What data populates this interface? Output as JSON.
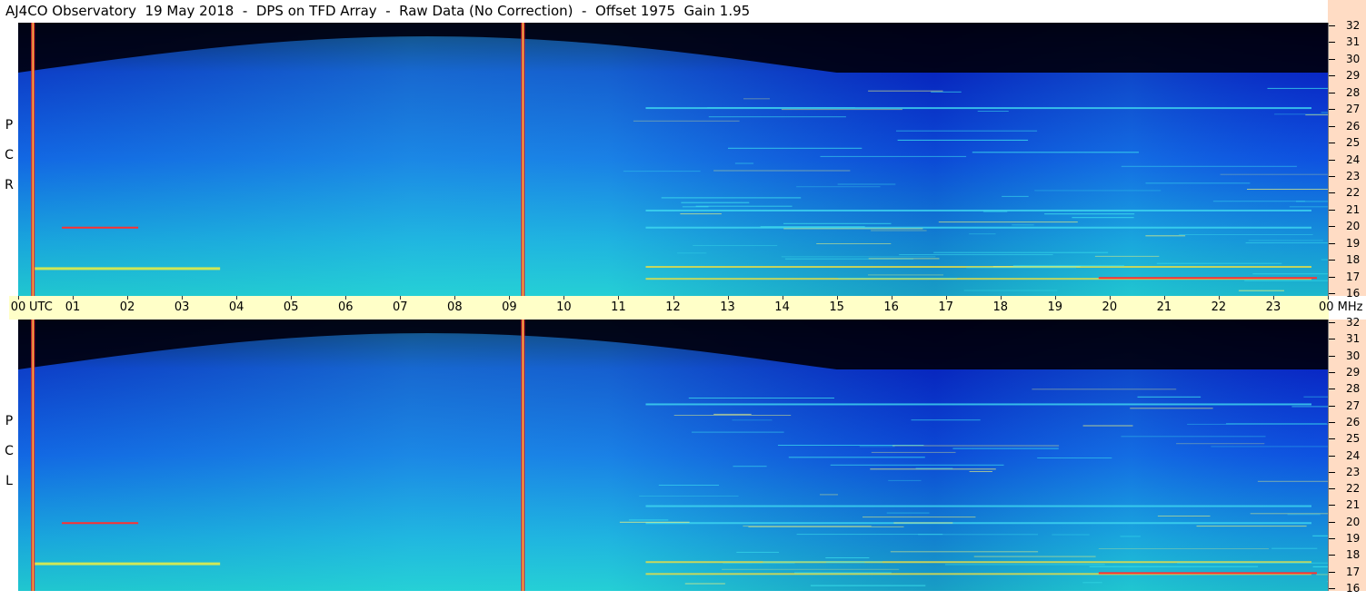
{
  "title": "AJ4CO Observatory  19 May 2018  -  DPS on TFD Array  -  Raw Data (No Correction)  -  Offset 1975  Gain 1.95",
  "panels": {
    "rcp_label": [
      "R",
      "C",
      "P"
    ],
    "lcp_label": [
      "L",
      "C",
      "P"
    ]
  },
  "time_axis": {
    "labels": [
      "00",
      "UTC",
      "01",
      "02",
      "03",
      "04",
      "05",
      "06",
      "07",
      "08",
      "09",
      "10",
      "11",
      "12",
      "13",
      "14",
      "15",
      "16",
      "17",
      "18",
      "19",
      "20",
      "21",
      "22",
      "23",
      "00 MHz"
    ],
    "hours": [
      0,
      0.3,
      1,
      2,
      3,
      4,
      5,
      6,
      7,
      8,
      9,
      10,
      11,
      12,
      13,
      14,
      15,
      16,
      17,
      18,
      19,
      20,
      21,
      22,
      23,
      24
    ]
  },
  "freq_axis": {
    "labels": [
      "32",
      "31",
      "30",
      "29",
      "28",
      "27",
      "26",
      "25",
      "24",
      "23",
      "22",
      "21",
      "20",
      "19",
      "18",
      "17",
      "16"
    ],
    "unit": "MHz"
  },
  "colors": {
    "background_top": "#000010",
    "spectrum_low": "#0a2fd0",
    "spectrum_high": "#1ec8d8",
    "axis_time_bg": "#ffffc8",
    "axis_freq_bg": "#ffdcc4",
    "burst_line": "#ff3030"
  },
  "chart_data": {
    "type": "heatmap",
    "title": "AJ4CO Observatory  19 May 2018  -  DPS on TFD Array  -  Raw Data (No Correction)  -  Offset 1975  Gain 1.95",
    "x_unit": "UTC hours",
    "y_unit": "MHz",
    "xlim": [
      0,
      24
    ],
    "ylim": [
      16,
      32
    ],
    "series": [
      {
        "name": "RCP"
      },
      {
        "name": "LCP"
      }
    ],
    "vertical_interference_lines_utc": [
      0.27,
      9.25
    ],
    "persistent_carriers_mhz": [
      17.0,
      17.7,
      20.0,
      21.0,
      27.0
    ],
    "colormap": "black-blue-cyan-yellow-red"
  }
}
